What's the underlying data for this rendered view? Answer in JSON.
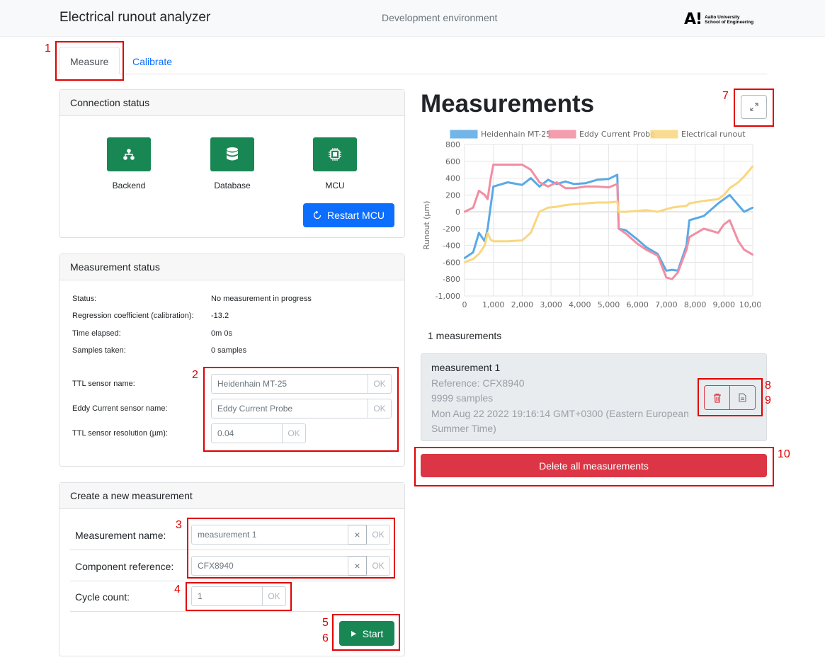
{
  "header": {
    "title": "Electrical runout analyzer",
    "environment": "Development environment",
    "logo_mark": "A!",
    "logo_line1": "Aalto University",
    "logo_line2": "School of Engineering"
  },
  "tabs": [
    {
      "label": "Measure",
      "active": true
    },
    {
      "label": "Calibrate",
      "active": false
    }
  ],
  "connection": {
    "title": "Connection status",
    "items": [
      {
        "label": "Backend",
        "icon": "network-icon"
      },
      {
        "label": "Database",
        "icon": "database-icon"
      },
      {
        "label": "MCU",
        "icon": "chip-icon"
      }
    ],
    "restart_label": "Restart MCU"
  },
  "measurement_status": {
    "title": "Measurement status",
    "rows": [
      {
        "label": "Status:",
        "value": "No measurement in progress"
      },
      {
        "label": "Regression coefficient (calibration):",
        "value": "-13.2"
      },
      {
        "label": "Time elapsed:",
        "value": "0m 0s"
      },
      {
        "label": "Samples taken:",
        "value": "0 samples"
      }
    ],
    "fields": [
      {
        "label": "TTL sensor name:",
        "value": "Heidenhain MT-25",
        "ok": "OK"
      },
      {
        "label": "Eddy Current sensor name:",
        "value": "Eddy Current Probe",
        "ok": "OK"
      },
      {
        "label": "TTL sensor resolution (µm):",
        "value": "0.04",
        "ok": "OK"
      }
    ]
  },
  "new_measurement": {
    "title": "Create a new measurement",
    "name_label": "Measurement name:",
    "name_value": "measurement 1",
    "ref_label": "Component reference:",
    "ref_value": "CFX8940",
    "cycle_label": "Cycle count:",
    "cycle_value": "1",
    "clear": "×",
    "ok": "OK",
    "start_label": "Start"
  },
  "measurements": {
    "title": "Measurements",
    "count_text": "1 measurements",
    "item": {
      "name": "measurement 1",
      "reference": "Reference: CFX8940",
      "samples": "9999 samples",
      "date_line1": "Mon Aug 22 2022 19:16:14 GMT+0300 (Eastern European",
      "date_line2": "Summer Time)"
    },
    "delete_all_label": "Delete all measurements"
  },
  "annotations": [
    "1",
    "2",
    "3",
    "4",
    "5",
    "6",
    "7",
    "8",
    "9",
    "10"
  ],
  "colors": {
    "accent": "#0d6efd",
    "success": "#198754",
    "danger": "#dc3545",
    "annotation": "#e00000"
  },
  "chart_data": {
    "type": "line",
    "title": "",
    "xlabel": "",
    "ylabel": "Runout (µm)",
    "xlim": [
      0,
      10000
    ],
    "ylim": [
      -1000,
      800
    ],
    "x_ticks": [
      "0",
      "1,000",
      "2,000",
      "3,000",
      "4,000",
      "5,000",
      "6,000",
      "7,000",
      "8,000",
      "9,000",
      "10,000"
    ],
    "y_ticks": [
      "800",
      "600",
      "400",
      "200",
      "0",
      "-200",
      "-400",
      "-600",
      "-800",
      "-1,000"
    ],
    "legend_position": "top",
    "grid": true,
    "x": [
      0,
      300,
      500,
      700,
      800,
      900,
      1000,
      1500,
      2000,
      2300,
      2600,
      2900,
      3200,
      3500,
      3800,
      4200,
      4600,
      5000,
      5300,
      5350,
      5600,
      6000,
      6300,
      6700,
      7000,
      7200,
      7400,
      7700,
      7800,
      8300,
      8800,
      9000,
      9200,
      9500,
      9700,
      10000
    ],
    "series": [
      {
        "name": "Heidenhain MT-25",
        "color": "#5aa9e6",
        "values": [
          -550,
          -480,
          -250,
          -350,
          -200,
          50,
          300,
          350,
          320,
          400,
          300,
          380,
          330,
          360,
          330,
          340,
          380,
          390,
          440,
          -200,
          -220,
          -330,
          -420,
          -500,
          -700,
          -690,
          -700,
          -400,
          -100,
          -50,
          100,
          150,
          200,
          80,
          0,
          50
        ]
      },
      {
        "name": "Eddy Current Probe",
        "color": "#f28da2",
        "values": [
          0,
          50,
          250,
          200,
          150,
          380,
          560,
          560,
          560,
          500,
          350,
          300,
          350,
          280,
          280,
          300,
          300,
          290,
          330,
          -200,
          -260,
          -380,
          -450,
          -520,
          -780,
          -800,
          -720,
          -450,
          -300,
          -200,
          -250,
          -150,
          -100,
          -350,
          -450,
          -510
        ]
      },
      {
        "name": "Electrical runout",
        "color": "#f9d77f",
        "values": [
          -600,
          -560,
          -500,
          -400,
          -250,
          -330,
          -350,
          -350,
          -340,
          -250,
          0,
          50,
          60,
          80,
          90,
          100,
          110,
          110,
          120,
          0,
          0,
          10,
          20,
          0,
          30,
          50,
          60,
          70,
          100,
          130,
          150,
          200,
          280,
          350,
          420,
          540
        ]
      }
    ]
  }
}
